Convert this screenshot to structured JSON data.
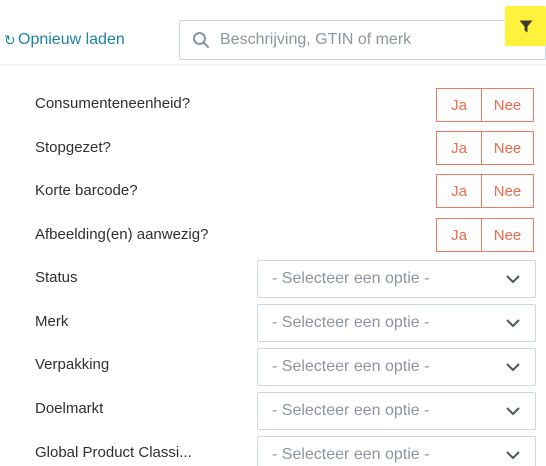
{
  "toolbar": {
    "reload_label": "Opnieuw laden",
    "search_placeholder": "Beschrijving, GTIN of merk"
  },
  "toggles": [
    {
      "label": "Consumenteneenheid?",
      "yes": "Ja",
      "no": "Nee"
    },
    {
      "label": "Stopgezet?",
      "yes": "Ja",
      "no": "Nee"
    },
    {
      "label": "Korte barcode?",
      "yes": "Ja",
      "no": "Nee"
    },
    {
      "label": "Afbeelding(en) aanwezig?",
      "yes": "Ja",
      "no": "Nee"
    }
  ],
  "selects": [
    {
      "label": "Status",
      "placeholder": "- Selecteer een optie -"
    },
    {
      "label": "Merk",
      "placeholder": "- Selecteer een optie -"
    },
    {
      "label": "Verpakking",
      "placeholder": "- Selecteer een optie -"
    },
    {
      "label": "Doelmarkt",
      "placeholder": "- Selecteer een optie -"
    },
    {
      "label": "Global Product Classi...",
      "placeholder": "- Selecteer een optie -"
    }
  ],
  "colors": {
    "accent_link": "#1f82a8",
    "toggle_border": "#ee7b60",
    "toggle_text": "#ee6a4b",
    "filter_highlight": "#fff23a",
    "field_border": "#c9d7e2",
    "placeholder": "#8a969f"
  },
  "icons": {
    "reload": "reload-icon",
    "search": "search-icon",
    "filter": "filter-icon",
    "dropdown": "chevron-down-icon"
  }
}
